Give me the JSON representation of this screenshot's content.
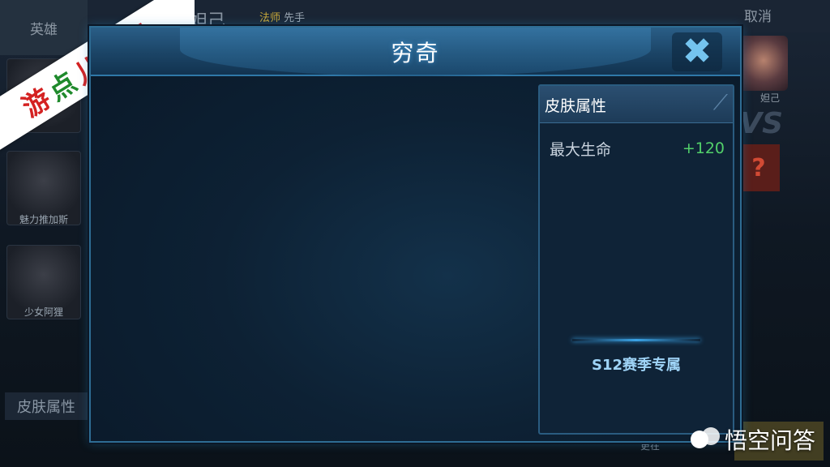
{
  "background": {
    "tab_label": "英雄",
    "cancel_label": "取消",
    "hero_name": "妲己",
    "tag_role": "法师",
    "tag_order": "先手",
    "heroes": [
      "魅力推加斯",
      "少女阿狸"
    ],
    "right_hero_name": "妲己",
    "vs_label": "VS",
    "question_mark": "?",
    "skin_attr_tab": "皮肤属性",
    "more_label": "更在"
  },
  "watermark": {
    "stamp_text": "游点儿出品",
    "corner_brand": "悟空问答"
  },
  "modal": {
    "title": "穷奇",
    "close_icon": "close-icon"
  },
  "attributes": {
    "header": "皮肤属性",
    "items": [
      {
        "name": "最大生命",
        "value": "+120"
      }
    ],
    "footer": "S12赛季专属"
  },
  "colors": {
    "value_positive": "#52d06a",
    "accent": "#3aa3e6",
    "title": "#ffffff"
  }
}
